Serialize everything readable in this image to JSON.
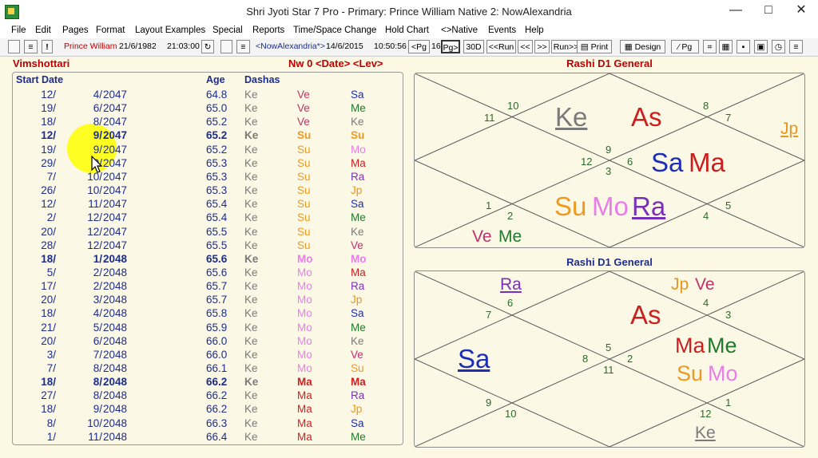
{
  "window": {
    "title": "Shri Jyoti Star 7 Pro  - Primary: Prince William     Native 2: NowAlexandria",
    "min_glyph": "—",
    "max_glyph": "□",
    "close_glyph": "✕"
  },
  "menu": [
    "File",
    "Edit",
    "Pages",
    "Format",
    "Layout Examples",
    "Special",
    "Reports",
    "Time/Space Change",
    "Hold Chart",
    "<>Native",
    "Events",
    "Help"
  ],
  "toolbar": {
    "native_name": "Prince William",
    "native_date": "21/6/1982",
    "native_time": "21:03:00",
    "native2_name": "<NowAlexandria*>",
    "native2_date": "14/6/2015",
    "native2_time": "10:50:56",
    "pg_prev": "<Pg",
    "pg_num": "16",
    "pg_next": "Pg>",
    "days": "30D",
    "run_back": "<<Run",
    "step_back": "<<",
    "step_fwd": ">>",
    "run_fwd": "Run>>",
    "print": "Print",
    "design": "Design",
    "pg": "Pg"
  },
  "dasha": {
    "title": "Vimshottari",
    "nav": "Nw 0 <Date> <Lev>",
    "headers": {
      "start_date": "Start Date",
      "age": "Age",
      "dashas": "Dashas"
    },
    "rows": [
      {
        "d": "12/",
        "m": "4/",
        "y": "2047",
        "age": "64.8",
        "l1": "Ke",
        "l2": "Ve",
        "l3": "Sa",
        "bold": false
      },
      {
        "d": "19/",
        "m": "6/",
        "y": "2047",
        "age": "65.0",
        "l1": "Ke",
        "l2": "Ve",
        "l3": "Me",
        "bold": false
      },
      {
        "d": "18/",
        "m": "8/",
        "y": "2047",
        "age": "65.2",
        "l1": "Ke",
        "l2": "Ve",
        "l3": "Ke",
        "bold": false
      },
      {
        "d": "12/",
        "m": "9/",
        "y": "2047",
        "age": "65.2",
        "l1": "Ke",
        "l2": "Su",
        "l3": "Su",
        "bold": true
      },
      {
        "d": "19/",
        "m": "9/",
        "y": "2047",
        "age": "65.2",
        "l1": "Ke",
        "l2": "Su",
        "l3": "Mo",
        "bold": false
      },
      {
        "d": "29/",
        "m": "9/",
        "y": "2047",
        "age": "65.3",
        "l1": "Ke",
        "l2": "Su",
        "l3": "Ma",
        "bold": false
      },
      {
        "d": "7/",
        "m": "10/",
        "y": "2047",
        "age": "65.3",
        "l1": "Ke",
        "l2": "Su",
        "l3": "Ra",
        "bold": false
      },
      {
        "d": "26/",
        "m": "10/",
        "y": "2047",
        "age": "65.3",
        "l1": "Ke",
        "l2": "Su",
        "l3": "Jp",
        "bold": false
      },
      {
        "d": "12/",
        "m": "11/",
        "y": "2047",
        "age": "65.4",
        "l1": "Ke",
        "l2": "Su",
        "l3": "Sa",
        "bold": false
      },
      {
        "d": "2/",
        "m": "12/",
        "y": "2047",
        "age": "65.4",
        "l1": "Ke",
        "l2": "Su",
        "l3": "Me",
        "bold": false
      },
      {
        "d": "20/",
        "m": "12/",
        "y": "2047",
        "age": "65.5",
        "l1": "Ke",
        "l2": "Su",
        "l3": "Ke",
        "bold": false
      },
      {
        "d": "28/",
        "m": "12/",
        "y": "2047",
        "age": "65.5",
        "l1": "Ke",
        "l2": "Su",
        "l3": "Ve",
        "bold": false
      },
      {
        "d": "18/",
        "m": "1/",
        "y": "2048",
        "age": "65.6",
        "l1": "Ke",
        "l2": "Mo",
        "l3": "Mo",
        "bold": true
      },
      {
        "d": "5/",
        "m": "2/",
        "y": "2048",
        "age": "65.6",
        "l1": "Ke",
        "l2": "Mo",
        "l3": "Ma",
        "bold": false
      },
      {
        "d": "17/",
        "m": "2/",
        "y": "2048",
        "age": "65.7",
        "l1": "Ke",
        "l2": "Mo",
        "l3": "Ra",
        "bold": false
      },
      {
        "d": "20/",
        "m": "3/",
        "y": "2048",
        "age": "65.7",
        "l1": "Ke",
        "l2": "Mo",
        "l3": "Jp",
        "bold": false
      },
      {
        "d": "18/",
        "m": "4/",
        "y": "2048",
        "age": "65.8",
        "l1": "Ke",
        "l2": "Mo",
        "l3": "Sa",
        "bold": false
      },
      {
        "d": "21/",
        "m": "5/",
        "y": "2048",
        "age": "65.9",
        "l1": "Ke",
        "l2": "Mo",
        "l3": "Me",
        "bold": false
      },
      {
        "d": "20/",
        "m": "6/",
        "y": "2048",
        "age": "66.0",
        "l1": "Ke",
        "l2": "Mo",
        "l3": "Ke",
        "bold": false
      },
      {
        "d": "3/",
        "m": "7/",
        "y": "2048",
        "age": "66.0",
        "l1": "Ke",
        "l2": "Mo",
        "l3": "Ve",
        "bold": false
      },
      {
        "d": "7/",
        "m": "8/",
        "y": "2048",
        "age": "66.1",
        "l1": "Ke",
        "l2": "Mo",
        "l3": "Su",
        "bold": false
      },
      {
        "d": "18/",
        "m": "8/",
        "y": "2048",
        "age": "66.2",
        "l1": "Ke",
        "l2": "Ma",
        "l3": "Ma",
        "bold": true
      },
      {
        "d": "27/",
        "m": "8/",
        "y": "2048",
        "age": "66.2",
        "l1": "Ke",
        "l2": "Ma",
        "l3": "Ra",
        "bold": false
      },
      {
        "d": "18/",
        "m": "9/",
        "y": "2048",
        "age": "66.2",
        "l1": "Ke",
        "l2": "Ma",
        "l3": "Jp",
        "bold": false
      },
      {
        "d": "8/",
        "m": "10/",
        "y": "2048",
        "age": "66.3",
        "l1": "Ke",
        "l2": "Ma",
        "l3": "Sa",
        "bold": false
      },
      {
        "d": "1/",
        "m": "11/",
        "y": "2048",
        "age": "66.4",
        "l1": "Ke",
        "l2": "Ma",
        "l3": "Me",
        "bold": false
      }
    ]
  },
  "planet_colors": {
    "Ke": "#7a7a7a",
    "Ve": "#c0306a",
    "Su": "#ee9a1e",
    "Mo": "#e77ee7",
    "Ma": "#cc1f1f",
    "Ra": "#7a2fb8",
    "Jp": "#e8961e",
    "Sa": "#1c2db8",
    "Me": "#1f7a2a",
    "As": "#cc1f1f"
  },
  "chart1": {
    "title": "Rashi D1 General",
    "houses": [
      "10",
      "11",
      "8",
      "7",
      "9",
      "12",
      "3",
      "6",
      "1",
      "2",
      "4",
      "5"
    ],
    "planets": {
      "Ke": "Ke",
      "As": "As",
      "Sa": "Sa",
      "Ma": "Ma",
      "Su": "Su",
      "Mo": "Mo",
      "Ra": "Ra",
      "Ve": "Ve",
      "Me": "Me",
      "Jp": "Jp"
    }
  },
  "chart2": {
    "title": "Rashi D1 General",
    "houses": [
      "6",
      "7",
      "4",
      "3",
      "5",
      "8",
      "11",
      "2",
      "9",
      "10",
      "12",
      "1"
    ],
    "planets": {
      "Ra": "Ra",
      "Jp": "Jp",
      "Ve": "Ve",
      "As": "As",
      "Sa": "Sa",
      "Ma": "Ma",
      "Me": "Me",
      "Su": "Su",
      "Mo": "Mo",
      "Ke": "Ke"
    }
  }
}
